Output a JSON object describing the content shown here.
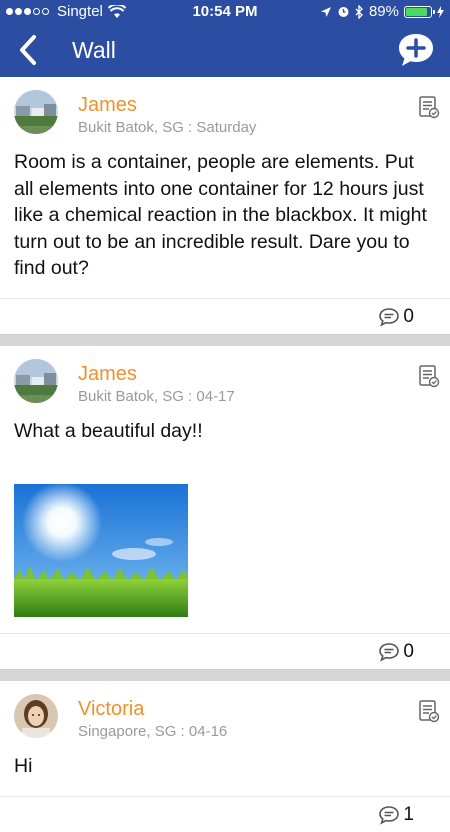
{
  "status_bar": {
    "carrier": "Singtel",
    "time": "10:54 PM",
    "battery": "89%",
    "battery_level": 0.89,
    "icons": [
      "signal-dots-icon",
      "wifi-icon",
      "location-arrow-icon",
      "alarm-icon",
      "bluetooth-icon",
      "battery-icon",
      "charging-icon"
    ]
  },
  "nav": {
    "title": "Wall",
    "back_icon": "chevron-left-icon",
    "add_icon": "add-comment-icon"
  },
  "posts": [
    {
      "author": "James",
      "meta": "Bukit Batok, SG : Saturday",
      "text": "Room is a container, people are elements. Put all elements into one container for 12 hours just like a chemical reaction in the blackbox. It might turn out to be an incredible result. Dare you to find out?",
      "comments": "0"
    },
    {
      "author": "James",
      "meta": "Bukit Batok, SG : 04-17",
      "text": "What a beautiful day!!",
      "comments": "0"
    },
    {
      "author": "Victoria",
      "meta": "Singapore, SG : 04-16",
      "text": "Hi",
      "comments": "1"
    }
  ],
  "colors": {
    "bar": "#2b4ea2",
    "author": "#f0912b",
    "meta": "#9a9a9a"
  }
}
